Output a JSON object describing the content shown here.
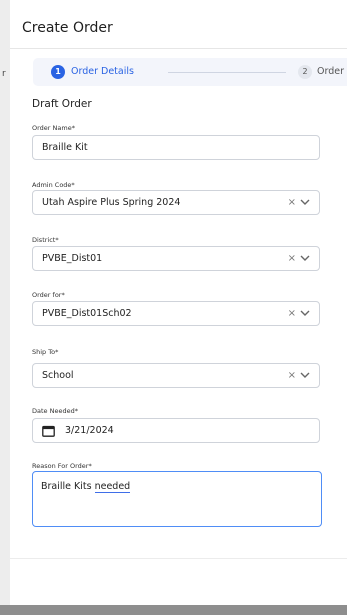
{
  "modal": {
    "title": "Create Order"
  },
  "background": {
    "fragment": "r"
  },
  "stepper": {
    "steps": [
      {
        "number": "1",
        "label": "Order Details",
        "active": true
      },
      {
        "number": "2",
        "label": "Order Ite",
        "active": false
      }
    ]
  },
  "form": {
    "section_title": "Draft Order",
    "order_name": {
      "label": "Order Name*",
      "value": "Braille Kit"
    },
    "admin_code": {
      "label": "Admin Code*",
      "value": "Utah Aspire Plus Spring 2024"
    },
    "district": {
      "label": "District*",
      "value": "PVBE_Dist01"
    },
    "order_for": {
      "label": "Order for*",
      "value": "PVBE_Dist01Sch02"
    },
    "ship_to": {
      "label": "Ship To*",
      "value": "School"
    },
    "date_needed": {
      "label": "Date Needed*",
      "value": "3/21/2024"
    },
    "reason": {
      "label": "Reason For Order*",
      "value_prefix": "Braille Kits ",
      "value_word": "needed"
    }
  },
  "icons": {
    "clear": "×"
  },
  "colors": {
    "accent": "#2a63e3",
    "focus_border": "#4f8df6"
  }
}
